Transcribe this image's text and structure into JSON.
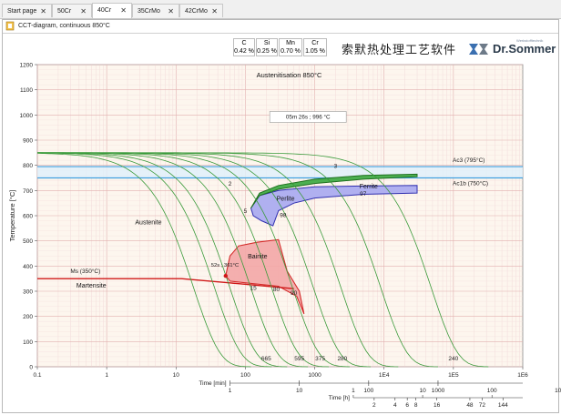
{
  "tabs": [
    {
      "label": "Start page",
      "active": false
    },
    {
      "label": "50Cr",
      "active": false
    },
    {
      "label": "40Cr",
      "active": true
    },
    {
      "label": "35CrMo",
      "active": false
    },
    {
      "label": "42CrMo",
      "active": false
    }
  ],
  "panel_title": "CCT-diagram, continuous 850°C",
  "composition": [
    {
      "element": "C",
      "value": "0.42 %"
    },
    {
      "element": "Si",
      "value": "0.25 %"
    },
    {
      "element": "Mn",
      "value": "0.70 %"
    },
    {
      "element": "Cr",
      "value": "1.05 %"
    }
  ],
  "logo": {
    "chinese": "索默热处理工艺软件",
    "brand": "Dr.Sommer",
    "tagline": "Werkstofftechnik"
  },
  "chart_data": {
    "type": "line",
    "title": "Austenitisation 850°C",
    "ylabel": "Temperature [°C]",
    "ylim": [
      0,
      1200
    ],
    "yticks": [
      0,
      100,
      200,
      300,
      400,
      500,
      600,
      700,
      800,
      900,
      1000,
      1100,
      1200
    ],
    "xscale": "log",
    "xlim": [
      0.1,
      1000000
    ],
    "xticks": [
      "0.1",
      "1",
      "10",
      "100",
      "1000",
      "1E4",
      "1E5",
      "1E6"
    ],
    "x_min_axis": {
      "label": "Time [min]",
      "ticks": [
        "1",
        "10",
        "100",
        "1000"
      ]
    },
    "x_h_axis": {
      "label": "Time [h]",
      "ticks": [
        "1",
        "10",
        "100",
        "1000",
        "10000"
      ],
      "subticks": [
        "2",
        "4",
        "6",
        "8",
        "16",
        "48",
        "72",
        "144"
      ]
    },
    "grid": true,
    "horizontal_lines": [
      {
        "name": "Ac3 (795°C)",
        "y": 795
      },
      {
        "name": "Ac1b (750°C)",
        "y": 750
      },
      {
        "name": "Ms (350°C)",
        "y": 350
      }
    ],
    "phase_regions": [
      {
        "name": "Ferrite",
        "color": "#4caf50"
      },
      {
        "name": "Perlite",
        "color": "#b0b0f0"
      },
      {
        "name": "Bainite",
        "color": "#f4a8a8"
      },
      {
        "name": "Austenite",
        "color": "none"
      },
      {
        "name": "Martensite",
        "color": "none"
      }
    ],
    "info_box": "05m 26s ; 996 °C",
    "marker_label": "52s ; 361°C",
    "cooling_curves": [
      {
        "hardness": "665",
        "end_time": 200
      },
      {
        "hardness": "595",
        "end_time": 600
      },
      {
        "hardness": "375",
        "end_time": 1200
      },
      {
        "hardness": "280",
        "end_time": 2500
      },
      {
        "hardness": "240",
        "end_time": 100000
      }
    ],
    "phase_percentages": [
      {
        "value": "2",
        "t": 60,
        "T": 720
      },
      {
        "value": "3",
        "t": 2000,
        "T": 790
      },
      {
        "value": "97",
        "t": 5000,
        "T": 680
      },
      {
        "value": "5",
        "t": 100,
        "T": 610
      },
      {
        "value": "98",
        "t": 350,
        "T": 595
      },
      {
        "value": "15",
        "t": 130,
        "T": 305
      },
      {
        "value": "80",
        "t": 280,
        "T": 300
      },
      {
        "value": "90",
        "t": 500,
        "T": 285
      }
    ]
  }
}
